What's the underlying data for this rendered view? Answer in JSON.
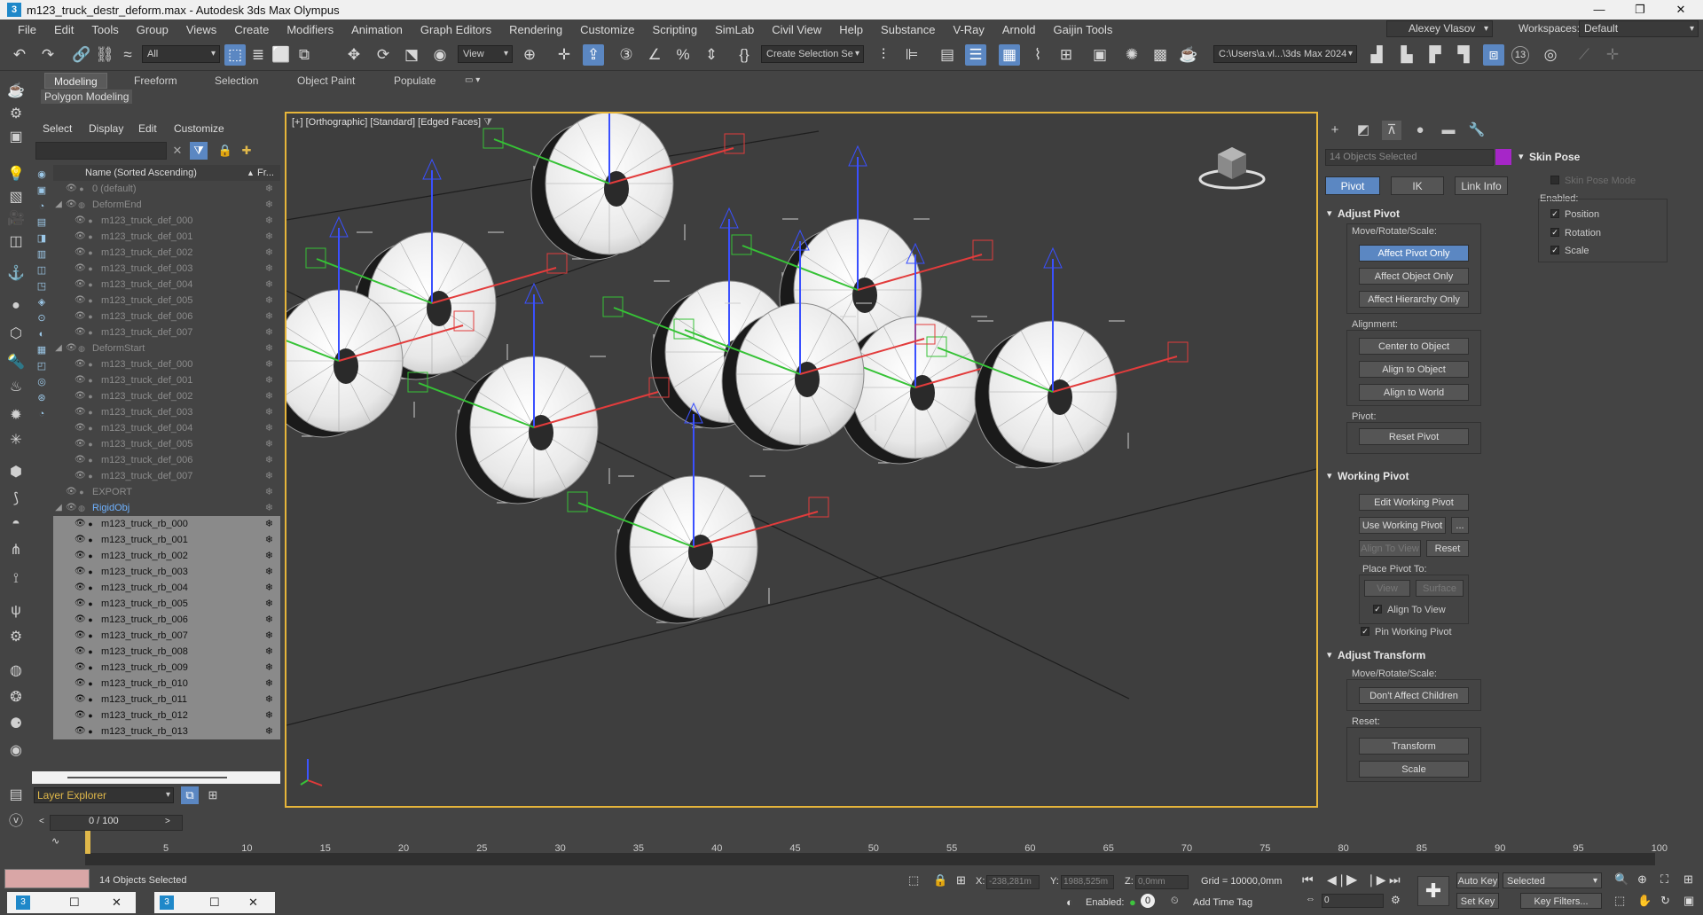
{
  "window": {
    "title": "m123_truck_destr_deform.max - Autodesk 3ds Max Olympus",
    "app_icon": "3"
  },
  "menu": [
    "File",
    "Edit",
    "Tools",
    "Group",
    "Views",
    "Create",
    "Modifiers",
    "Animation",
    "Graph Editors",
    "Rendering",
    "Customize",
    "Scripting",
    "SimLab",
    "Civil View",
    "Help",
    "Substance",
    "V-Ray",
    "Arnold",
    "Gaijin Tools"
  ],
  "user": {
    "name": "Alexey Vlasov",
    "workspaces_label": "Workspaces:",
    "workspace": "Default"
  },
  "toolbar": {
    "selection_filter": "All",
    "ref_coord": "View",
    "named_selection": "Create Selection Se",
    "path": "C:\\Users\\a.vl...\\3ds Max 2024",
    "badge": "13"
  },
  "ribbon": {
    "tabs": [
      "Modeling",
      "Freeform",
      "Selection",
      "Object Paint",
      "Populate"
    ],
    "active": "Modeling",
    "subtab": "Polygon Modeling"
  },
  "scene_explorer": {
    "tabs": [
      "Select",
      "Display",
      "Edit",
      "Customize"
    ],
    "column_name": "Name (Sorted Ascending)",
    "column_frozen": "Fr...",
    "rows": [
      {
        "name": "0 (default)",
        "indent": 1,
        "selected": false,
        "layer": true
      },
      {
        "name": "DeformEnd",
        "indent": 1,
        "selected": false,
        "group": true
      },
      {
        "name": "m123_truck_def_000",
        "indent": 2,
        "selected": false
      },
      {
        "name": "m123_truck_def_001",
        "indent": 2,
        "selected": false
      },
      {
        "name": "m123_truck_def_002",
        "indent": 2,
        "selected": false
      },
      {
        "name": "m123_truck_def_003",
        "indent": 2,
        "selected": false
      },
      {
        "name": "m123_truck_def_004",
        "indent": 2,
        "selected": false
      },
      {
        "name": "m123_truck_def_005",
        "indent": 2,
        "selected": false
      },
      {
        "name": "m123_truck_def_006",
        "indent": 2,
        "selected": false
      },
      {
        "name": "m123_truck_def_007",
        "indent": 2,
        "selected": false
      },
      {
        "name": "DeformStart",
        "indent": 1,
        "selected": false,
        "group": true
      },
      {
        "name": "m123_truck_def_000",
        "indent": 2,
        "selected": false
      },
      {
        "name": "m123_truck_def_001",
        "indent": 2,
        "selected": false
      },
      {
        "name": "m123_truck_def_002",
        "indent": 2,
        "selected": false
      },
      {
        "name": "m123_truck_def_003",
        "indent": 2,
        "selected": false
      },
      {
        "name": "m123_truck_def_004",
        "indent": 2,
        "selected": false
      },
      {
        "name": "m123_truck_def_005",
        "indent": 2,
        "selected": false
      },
      {
        "name": "m123_truck_def_006",
        "indent": 2,
        "selected": false
      },
      {
        "name": "m123_truck_def_007",
        "indent": 2,
        "selected": false
      },
      {
        "name": "EXPORT",
        "indent": 1,
        "selected": false,
        "layer": true
      },
      {
        "name": "RigidObj",
        "indent": 1,
        "selected": false,
        "group": true,
        "active": true
      },
      {
        "name": "m123_truck_rb_000",
        "indent": 2,
        "selected": true
      },
      {
        "name": "m123_truck_rb_001",
        "indent": 2,
        "selected": true
      },
      {
        "name": "m123_truck_rb_002",
        "indent": 2,
        "selected": true
      },
      {
        "name": "m123_truck_rb_003",
        "indent": 2,
        "selected": true
      },
      {
        "name": "m123_truck_rb_004",
        "indent": 2,
        "selected": true
      },
      {
        "name": "m123_truck_rb_005",
        "indent": 2,
        "selected": true
      },
      {
        "name": "m123_truck_rb_006",
        "indent": 2,
        "selected": true
      },
      {
        "name": "m123_truck_rb_007",
        "indent": 2,
        "selected": true
      },
      {
        "name": "m123_truck_rb_008",
        "indent": 2,
        "selected": true
      },
      {
        "name": "m123_truck_rb_009",
        "indent": 2,
        "selected": true
      },
      {
        "name": "m123_truck_rb_010",
        "indent": 2,
        "selected": true
      },
      {
        "name": "m123_truck_rb_011",
        "indent": 2,
        "selected": true
      },
      {
        "name": "m123_truck_rb_012",
        "indent": 2,
        "selected": true
      },
      {
        "name": "m123_truck_rb_013",
        "indent": 2,
        "selected": true
      }
    ],
    "layer_explorer": "Layer Explorer"
  },
  "viewport": {
    "label": "[+] [Orthographic] [Standard] [Edged Faces]"
  },
  "command_panel": {
    "selection": "14 Objects Selected",
    "swatch_color": "#a626c8",
    "tabs": [
      "Pivot",
      "IK",
      "Link Info"
    ],
    "adjust_pivot": {
      "title": "Adjust Pivot",
      "mrs_label": "Move/Rotate/Scale:",
      "buttons": [
        "Affect Pivot Only",
        "Affect Object Only",
        "Affect Hierarchy Only"
      ],
      "alignment_label": "Alignment:",
      "align_buttons": [
        "Center to Object",
        "Align to Object",
        "Align to World"
      ],
      "pivot_label": "Pivot:",
      "reset_pivot": "Reset Pivot"
    },
    "working_pivot": {
      "title": "Working Pivot",
      "edit": "Edit Working Pivot",
      "use": "Use Working Pivot",
      "use_more": "...",
      "align_to_view": "Align To View",
      "reset": "Reset",
      "place_label": "Place Pivot To:",
      "view": "View",
      "surface": "Surface",
      "align_to_view_chk": "Align To View",
      "pin": "Pin Working Pivot"
    },
    "adjust_transform": {
      "title": "Adjust Transform",
      "mrs_label": "Move/Rotate/Scale:",
      "dont_affect": "Don't Affect Children",
      "reset_label": "Reset:",
      "transform": "Transform",
      "scale": "Scale"
    },
    "skin_pose": {
      "title": "Skin Pose",
      "mode": "Skin Pose Mode",
      "enabled_label": "Enabled:",
      "position": "Position",
      "rotation": "Rotation",
      "scale": "Scale"
    }
  },
  "timeline": {
    "frame_display": "0 / 100",
    "ticks": [
      "5",
      "10",
      "15",
      "20",
      "25",
      "30",
      "35",
      "40",
      "45",
      "50",
      "55",
      "60",
      "65",
      "70",
      "75",
      "80",
      "85",
      "90",
      "95",
      "100"
    ]
  },
  "status": {
    "selected": "14 Objects Selected",
    "x_label": "X:",
    "x": "-238,281m",
    "y_label": "Y:",
    "y": "1988,525m",
    "z_label": "Z:",
    "z": "0,0mm",
    "grid": "Grid = 10000,0mm",
    "enabled_label": "Enabled:",
    "enabled_value": "0",
    "add_time_tag": "Add Time Tag",
    "auto_key": "Auto Key",
    "set_key": "Set Key",
    "selected_dd": "Selected",
    "key_filters": "Key Filters...",
    "frame": "0"
  }
}
